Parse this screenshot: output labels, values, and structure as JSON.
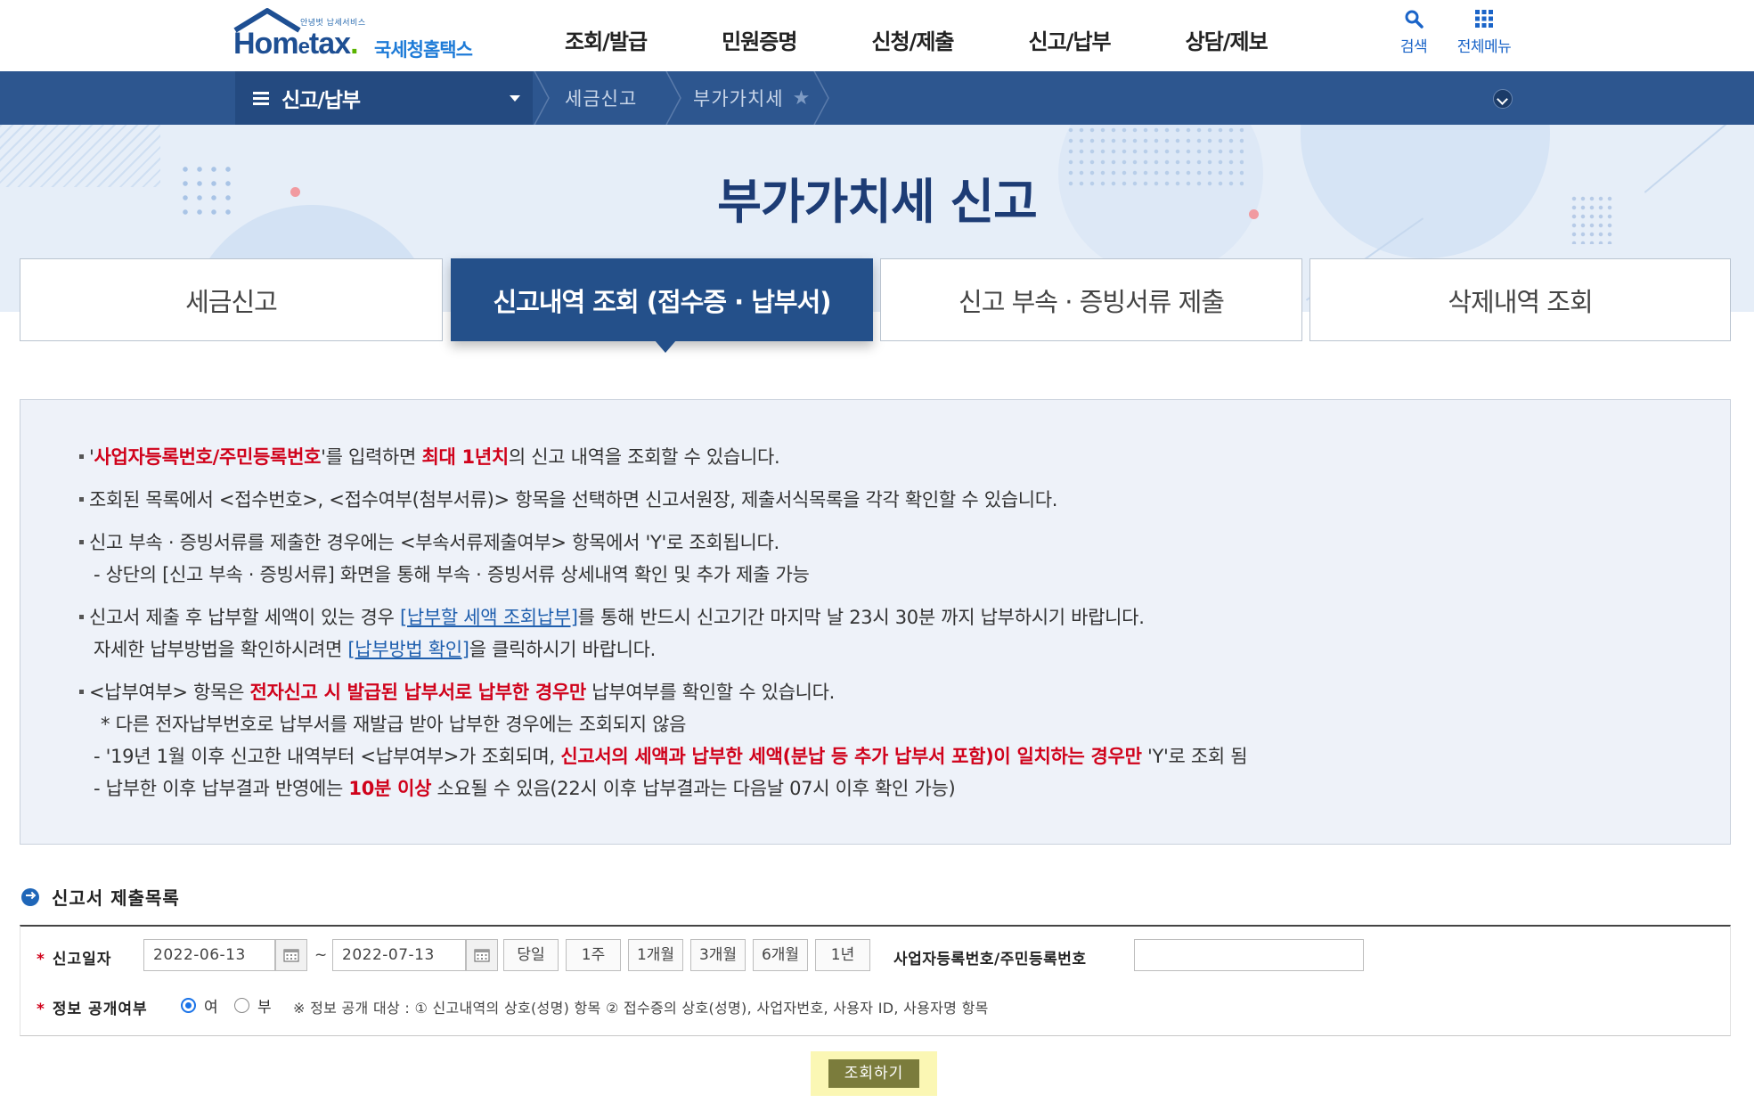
{
  "header": {
    "logo_sub": "안녕벗 납세서비스",
    "logo_brand_a": "Hom",
    "logo_brand_e": "e",
    "logo_brand_b": "tax",
    "logo_agency": "국세청홈택스",
    "nav": [
      "조회/발급",
      "민원증명",
      "신청/제출",
      "신고/납부",
      "상담/제보"
    ],
    "search_label": "검색",
    "allmenu_label": "전체메뉴"
  },
  "location": {
    "menu": "신고/납부",
    "crumbs": [
      "세금신고",
      "부가가치세"
    ]
  },
  "page_title": "부가가치세 신고",
  "tabs": [
    {
      "label": "세금신고",
      "active": false
    },
    {
      "label": "신고내역 조회 (접수증 · 납부서)",
      "active": true
    },
    {
      "label": "신고 부속 · 증빙서류 제출",
      "active": false
    },
    {
      "label": "삭제내역 조회",
      "active": false
    }
  ],
  "info": {
    "l1_q1": "'",
    "l1_red1": "사업자등록번호/주민등록번호",
    "l1_t1": "'를 입력하면 ",
    "l1_red2": "최대 1년치",
    "l1_t2": "의 신고 내역을 조회할 수 있습니다.",
    "l2": "조회된 목록에서 <접수번호>, <접수여부(첨부서류)> 항목을 선택하면 신고서원장, 제출서식목록을 각각 확인할 수 있습니다.",
    "l3": "신고 부속 · 증빙서류를 제출한 경우에는 <부속서류제출여부> 항목에서 'Y'로 조회됩니다.",
    "l3_sub": "- 상단의 [신고 부속 · 증빙서류] 화면을 통해 부속 · 증빙서류 상세내역 확인 및 추가 제출 가능",
    "l4_t1": "신고서 제출 후 납부할 세액이 있는 경우 ",
    "l4_link": "[납부할 세액 조회납부]",
    "l4_t2": "를 통해 반드시 신고기간 마지막 날 23시 30분 까지 납부하시기 바랍니다.",
    "l4b_t1": "자세한 납부방법을 확인하시려면 ",
    "l4b_link": "[납부방법 확인]",
    "l4b_t2": "을 클릭하시기 바랍니다.",
    "l5_t1": "<납부여부> 항목은 ",
    "l5_red": "전자신고 시 발급된 납부서로 납부한 경우만",
    "l5_t2": " 납부여부를 확인할 수 있습니다.",
    "l5_note": "* 다른 전자납부번호로 납부서를 재발급 받아 납부한 경우에는 조회되지 않음",
    "l6_t1": "- '19년 1월 이후 신고한 내역부터 <납부여부>가 조회되며, ",
    "l6_red": "신고서의 세액과 납부한 세액(분납 등 추가 납부서 포함)이 일치하는 경우만",
    "l6_t2": " 'Y'로 조회 됨",
    "l7_t1": "- 납부한 이후 납부결과 반영에는 ",
    "l7_red": "10분 이상",
    "l7_t2": " 소요될 수 있음(22시 이후 납부결과는 다음날 07시 이후 확인 가능)"
  },
  "section_title": "신고서 제출목록",
  "form": {
    "date_label": "신고일자",
    "date_from": "2022-06-13",
    "date_tilde": "~",
    "date_to": "2022-07-13",
    "period_buttons": [
      "당일",
      "1주",
      "1개월",
      "3개월",
      "6개월",
      "1년"
    ],
    "biz_label": "사업자등록번호/주민등록번호",
    "biz_value": "",
    "public_label": "정보 공개여부",
    "radio_yes": "여",
    "radio_no": "부",
    "public_selected": "여",
    "note": "※ 정보 공개 대상 : ① 신고내역의 상호(성명) 항목 ② 접수증의 상호(성명), 사업자번호, 사용자 ID, 사용자명 항목"
  },
  "search_button": "조회하기",
  "colors": {
    "brand": "#1e4f93",
    "location_bar": "#2d568f",
    "active_tab": "#24508a",
    "highlight_red": "#d0021b",
    "link": "#1f5fae",
    "search_button": "#7b7c3c"
  }
}
